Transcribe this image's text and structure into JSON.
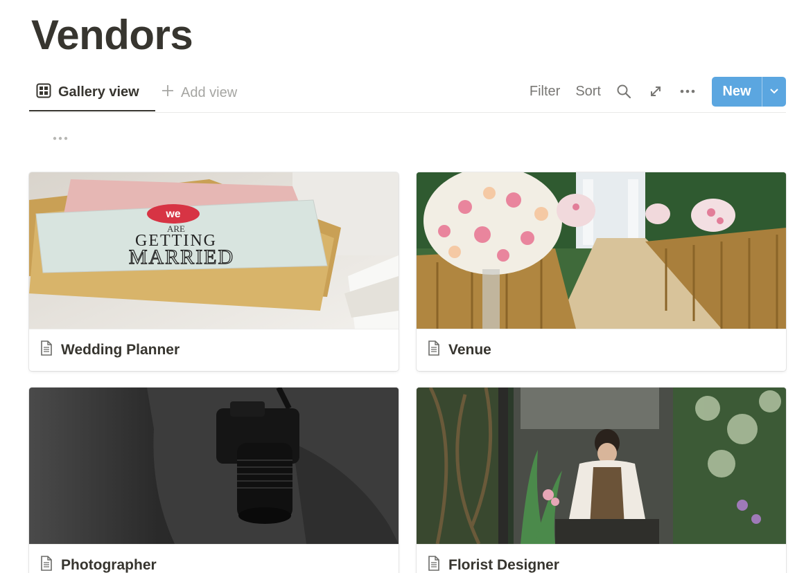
{
  "page": {
    "title": "Vendors"
  },
  "views": {
    "active_tab": {
      "label": "Gallery view",
      "icon": "gallery-grid-icon"
    },
    "add_view": {
      "label": "Add view",
      "icon": "plus-icon"
    }
  },
  "toolbar": {
    "filter_label": "Filter",
    "sort_label": "Sort",
    "search_icon": "search-icon",
    "expand_icon": "expand-icon",
    "more_icon": "more-horizontal-icon",
    "new_label": "New",
    "new_dropdown_icon": "chevron-down-icon",
    "accent_color": "#5ba6e0"
  },
  "gallery": {
    "cards": [
      {
        "title": "Wedding Planner",
        "icon": "page-icon",
        "cover": "we are getting married card photo"
      },
      {
        "title": "Venue",
        "icon": "page-icon",
        "cover": "wedding aisle with flower bouquets photo"
      },
      {
        "title": "Photographer",
        "icon": "page-icon",
        "cover": "camera strap black and white photo"
      },
      {
        "title": "Florist Designer",
        "icon": "page-icon",
        "cover": "florist in flower shop photo"
      }
    ]
  }
}
